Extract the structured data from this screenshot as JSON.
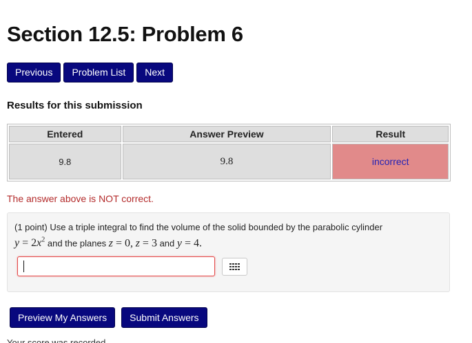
{
  "page": {
    "title": "Section 12.5: Problem 6"
  },
  "nav": {
    "previous_label": "Previous",
    "problem_list_label": "Problem List",
    "next_label": "Next"
  },
  "results": {
    "heading": "Results for this submission",
    "columns": [
      "Entered",
      "Answer Preview",
      "Result"
    ],
    "row": {
      "entered": "9.8",
      "preview": "9.8",
      "result": "incorrect"
    }
  },
  "feedback": {
    "message": "The answer above is NOT correct."
  },
  "problem": {
    "points": "(1 point)",
    "text_part1": "Use a triple integral to find the volume of the solid bounded by the parabolic cylinder",
    "eq1_lhs": "y",
    "eq1_rhs": "= 2",
    "eq1_var": "x",
    "eq1_exp": "2",
    "and_planes": "and the planes",
    "plane_z1": "z",
    "plane_z1_val": "= 0,",
    "plane_z2": "z",
    "plane_z2_val": "= 3",
    "and_word": "and",
    "plane_y": "y",
    "plane_y_val": "= 4.",
    "answer_value": "",
    "palette_icon": "equation-palette-icon"
  },
  "actions": {
    "preview_label": "Preview My Answers",
    "submit_label": "Submit Answers"
  },
  "footer": {
    "cutoff_text": "Your score was recorded."
  },
  "colors": {
    "button_bg": "#08087e",
    "incorrect_bg": "#e18a8a",
    "error_text": "#b32a2a",
    "input_error_border": "#e44a4a"
  }
}
